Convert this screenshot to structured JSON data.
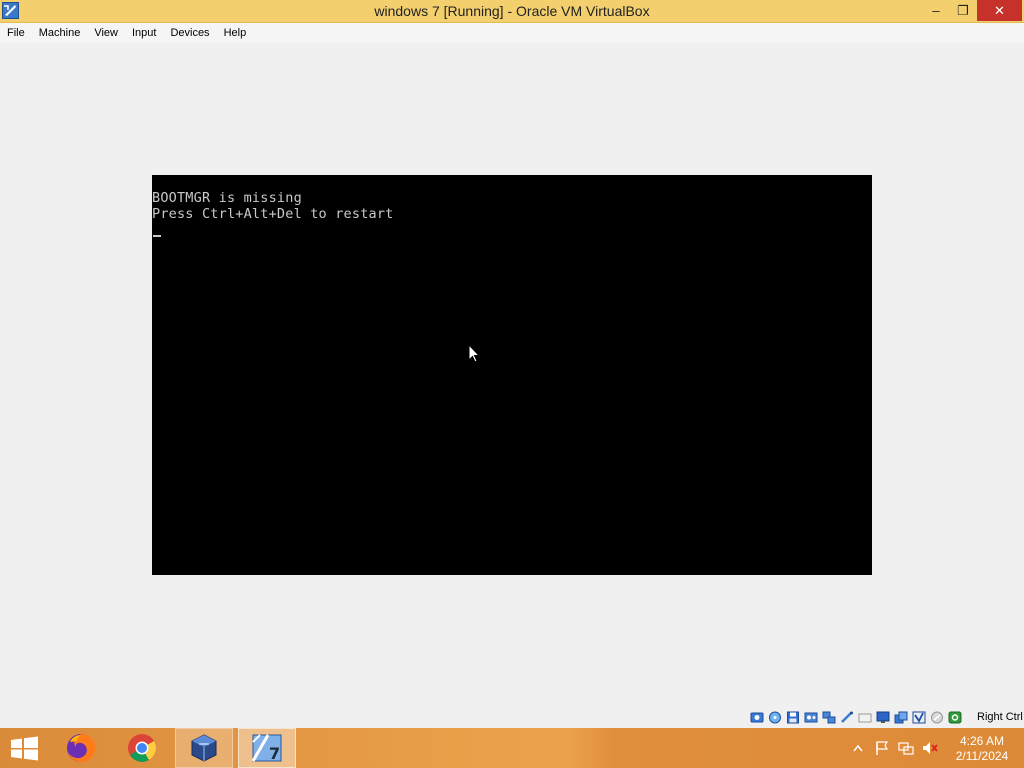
{
  "window": {
    "title": "windows 7 [Running] - Oracle VM VirtualBox",
    "minimize_glyph": "–",
    "restore_glyph": "❐",
    "close_glyph": "✕"
  },
  "menu": {
    "items": [
      "File",
      "Machine",
      "View",
      "Input",
      "Devices",
      "Help"
    ]
  },
  "console": {
    "line1": "BOOTMGR is missing",
    "line2": "Press Ctrl+Alt+Del to restart"
  },
  "statusbar": {
    "icons": [
      "hard-disk-icon",
      "optical-drive-icon",
      "floppy-icon",
      "audio-icon",
      "network-icon",
      "usb-icon",
      "shared-folders-icon",
      "display-icon",
      "recording-icon",
      "virtualization-icon",
      "mouse-integration-icon",
      "keyboard-capture-icon"
    ],
    "host_key": "Right Ctrl"
  },
  "taskbar": {
    "apps": [
      "start-icon",
      "firefox-icon",
      "chrome-icon",
      "virtualbox-icon",
      "windows7-vm-icon"
    ],
    "tray": [
      "show-hidden-icons-icon",
      "action-center-flag-icon",
      "network-tray-icon",
      "volume-muted-icon"
    ],
    "time": "4:26 AM",
    "date": "2/11/2024"
  },
  "colors": {
    "titlebar": "#f3cf6e",
    "close_button": "#c7312b",
    "taskbar": "#e69a45",
    "console_text": "#c8c8c8"
  }
}
